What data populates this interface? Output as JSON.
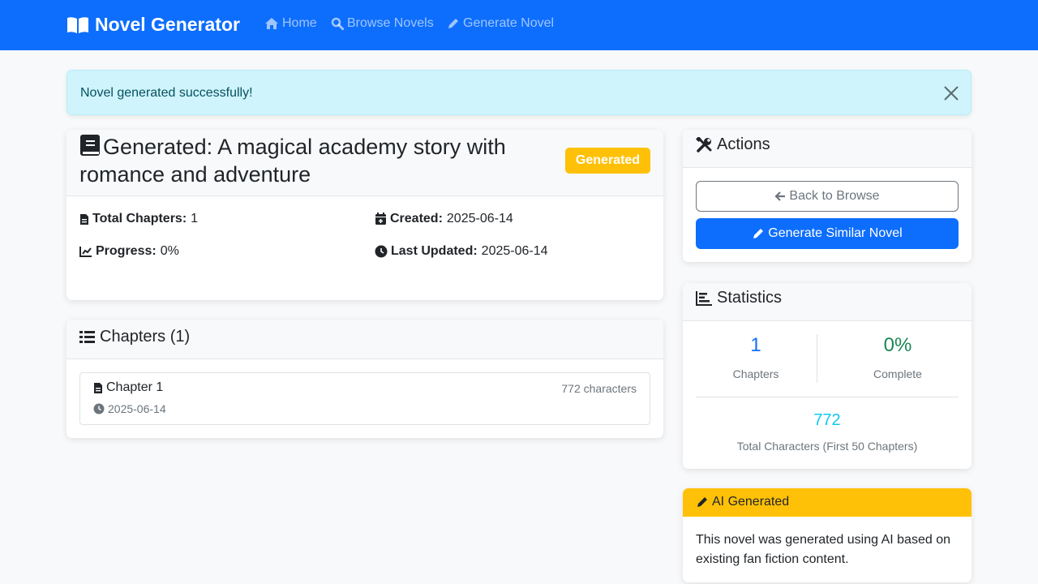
{
  "nav": {
    "brand": "Novel Generator",
    "links": [
      "Home",
      "Browse Novels",
      "Generate Novel"
    ]
  },
  "alert": {
    "message": "Novel generated successfully!"
  },
  "novel": {
    "title": "Generated: A magical academy story with romance and adventure",
    "badge": "Generated",
    "meta": {
      "total_chapters_label": "Total Chapters:",
      "total_chapters": "1",
      "created_label": "Created:",
      "created": "2025-06-14",
      "progress_label": "Progress:",
      "progress": "0%",
      "updated_label": "Last Updated:",
      "updated": "2025-06-14"
    }
  },
  "chapters": {
    "header": "Chapters (1)",
    "items": [
      {
        "title": "Chapter 1",
        "chars": "772 characters",
        "date": "2025-06-14"
      }
    ]
  },
  "actions": {
    "header": "Actions",
    "back": "Back to Browse",
    "similar": "Generate Similar Novel"
  },
  "statistics": {
    "header": "Statistics",
    "chapters_value": "1",
    "chapters_label": "Chapters",
    "complete_value": "0%",
    "complete_label": "Complete",
    "chars_value": "772",
    "chars_label": "Total Characters (First 50 Chapters)"
  },
  "ai": {
    "header": "AI Generated",
    "text": "This novel was generated using AI based on existing fan fiction content."
  },
  "colors": {
    "primary": "#0d6efd",
    "warning": "#ffc107",
    "success": "#198754",
    "info": "#0dcaf0"
  }
}
